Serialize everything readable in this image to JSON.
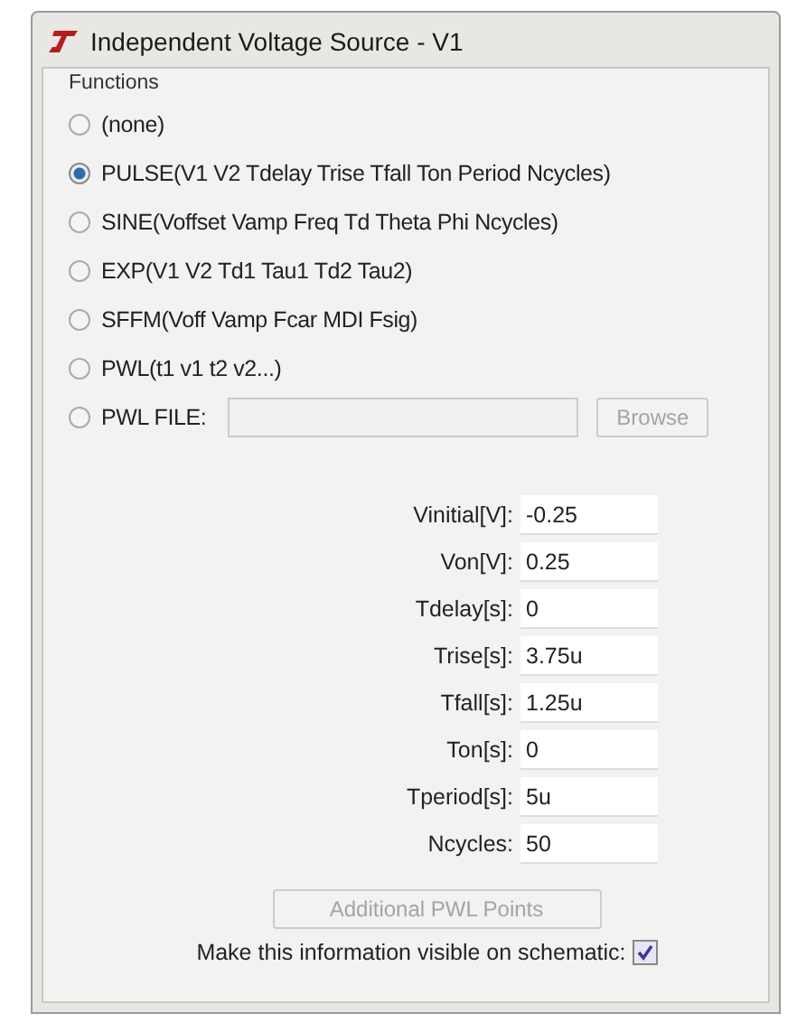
{
  "window": {
    "title": "Independent Voltage Source - V1"
  },
  "functions": {
    "label": "Functions",
    "options": [
      {
        "label": "(none)",
        "selected": false
      },
      {
        "label": "PULSE(V1 V2 Tdelay Trise Tfall Ton Period Ncycles)",
        "selected": true
      },
      {
        "label": "SINE(Voffset Vamp Freq Td Theta Phi Ncycles)",
        "selected": false
      },
      {
        "label": "EXP(V1 V2 Td1 Tau1 Td2 Tau2)",
        "selected": false
      },
      {
        "label": "SFFM(Voff Vamp Fcar MDI Fsig)",
        "selected": false
      },
      {
        "label": "PWL(t1 v1 t2 v2...)",
        "selected": false
      },
      {
        "label": "PWL FILE:",
        "selected": false
      }
    ],
    "file_field": {
      "disabled": true
    },
    "browse_button": {
      "label": "Browse",
      "disabled": true
    }
  },
  "parameters": [
    {
      "label": "Vinitial[V]:",
      "value": "-0.25"
    },
    {
      "label": "Von[V]:",
      "value": "0.25"
    },
    {
      "label": "Tdelay[s]:",
      "value": "0"
    },
    {
      "label": "Trise[s]:",
      "value": "3.75u"
    },
    {
      "label": "Tfall[s]:",
      "value": "1.25u"
    },
    {
      "label": "Ton[s]:",
      "value": "0"
    },
    {
      "label": "Tperiod[s]:",
      "value": "5u"
    },
    {
      "label": "Ncycles:",
      "value": "50"
    }
  ],
  "pwl_button": {
    "label": "Additional PWL Points",
    "disabled": true
  },
  "visible_on_schematic": {
    "label": "Make this information visible on schematic:",
    "checked": true
  }
}
